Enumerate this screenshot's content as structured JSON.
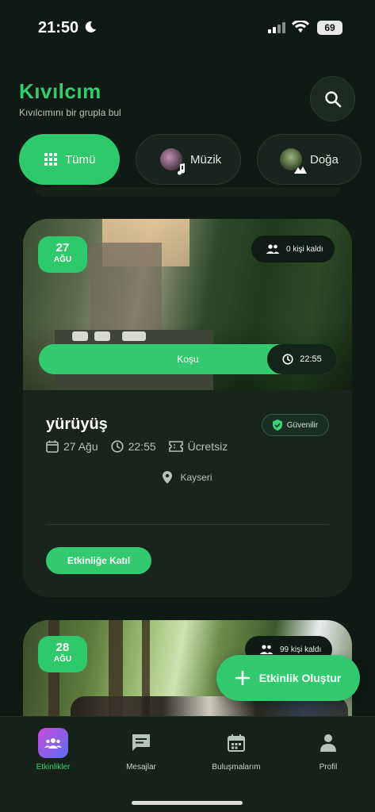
{
  "status_bar": {
    "time": "21:50",
    "battery": "69"
  },
  "header": {
    "title": "Kıvılcım",
    "subtitle": "Kıvılcımını bir grupla bul",
    "search_icon": "search-icon"
  },
  "categories": [
    {
      "label": "Tümü",
      "icon": "grid-icon",
      "active": true
    },
    {
      "label": "Müzik",
      "icon": "music-note-icon",
      "active": false
    },
    {
      "label": "Doğa",
      "icon": "landscape-icon",
      "active": false
    }
  ],
  "events": [
    {
      "day": "27",
      "month": "AĞU",
      "spots_left": "0 kişi kaldı",
      "tag": "Koşu",
      "tag_time": "22:55",
      "title": "yürüyüş",
      "trusted_label": "Güvenilir",
      "date_text": "27 Ağu",
      "time_text": "22:55",
      "price_text": "Ücretsiz",
      "location": "Kayseri",
      "join_label": "Etkinliğe Katıl"
    },
    {
      "day": "28",
      "month": "AĞU",
      "spots_left": "99 kişi kaldı"
    }
  ],
  "fab": {
    "label": "Etkinlik Oluştur"
  },
  "bottom_nav": [
    {
      "label": "Etkinlikler",
      "icon": "groups-icon",
      "active": true
    },
    {
      "label": "Mesajlar",
      "icon": "chat-icon",
      "active": false
    },
    {
      "label": "Buluşmalarım",
      "icon": "calendar-icon",
      "active": false
    },
    {
      "label": "Profil",
      "icon": "person-icon",
      "active": false
    }
  ],
  "colors": {
    "accent": "#33c96e",
    "background": "#0f1a14",
    "card": "#18241c",
    "title": "#33cc6e"
  }
}
